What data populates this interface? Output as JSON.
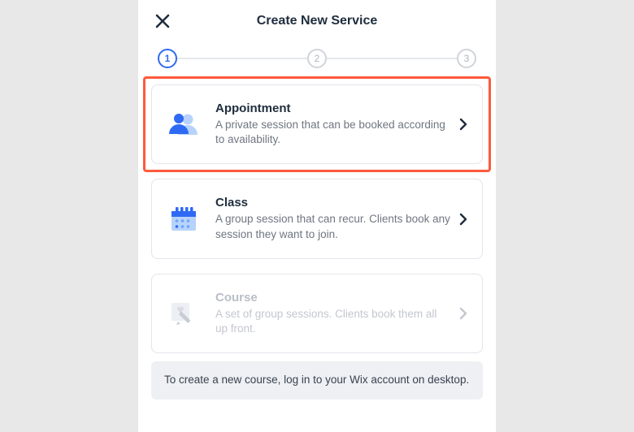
{
  "header": {
    "title": "Create New Service"
  },
  "stepper": {
    "step1": "1",
    "step2": "2",
    "step3": "3"
  },
  "options": {
    "appointment": {
      "title": "Appointment",
      "desc": "A private session that can be booked according to availability."
    },
    "class": {
      "title": "Class",
      "desc": "A group session that can recur. Clients book any session they want to join."
    },
    "course": {
      "title": "Course",
      "desc": "A set of group sessions. Clients book them all up front."
    }
  },
  "notice": {
    "text": "To create a new course, log in to your Wix account on desktop."
  }
}
